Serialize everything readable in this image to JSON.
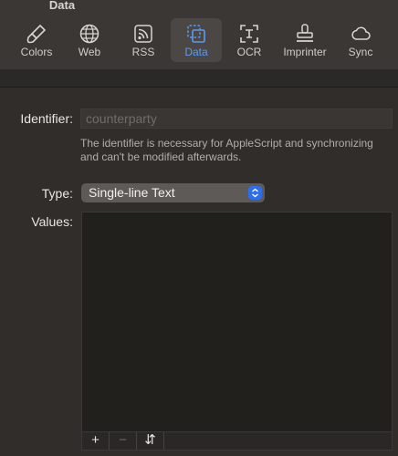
{
  "window": {
    "title": "Data"
  },
  "toolbar": {
    "tabs": [
      {
        "label": "Colors",
        "icon": "brush-icon"
      },
      {
        "label": "Web",
        "icon": "globe-icon"
      },
      {
        "label": "RSS",
        "icon": "rss-icon"
      },
      {
        "label": "Data",
        "icon": "data-copy-icon",
        "active": true
      },
      {
        "label": "OCR",
        "icon": "ocr-icon"
      },
      {
        "label": "Imprinter",
        "icon": "stamp-icon"
      },
      {
        "label": "Sync",
        "icon": "cloud-icon"
      }
    ]
  },
  "form": {
    "identifier_label": "Identifier:",
    "identifier_value": "counterparty",
    "help_text": "The identifier is necessary for AppleScript and synchronizing and can't be modified afterwards.",
    "type_label": "Type:",
    "type_value": "Single-line Text",
    "values_label": "Values:"
  },
  "values_buttons": {
    "add": "+",
    "remove": "−",
    "sort": "⇵"
  },
  "colors": {
    "accent": "#5b9bf5",
    "popup_stepper": "#2e6ee6"
  }
}
